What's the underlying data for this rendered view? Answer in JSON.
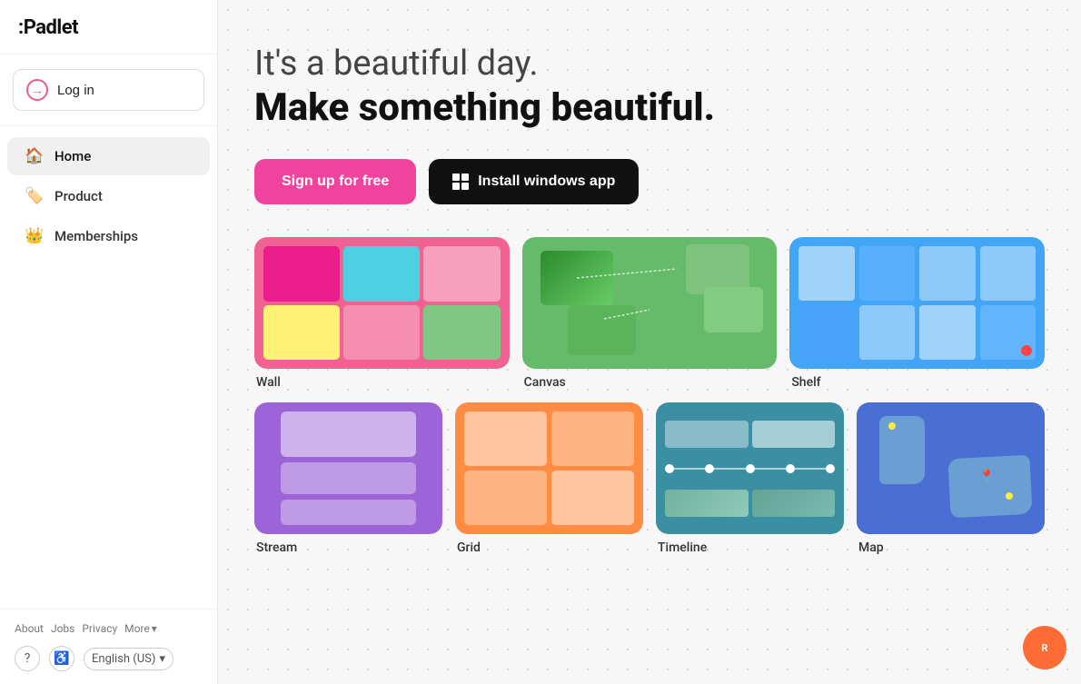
{
  "brand": {
    "logo": ":Padlet"
  },
  "sidebar": {
    "login_label": "Log in",
    "nav_items": [
      {
        "id": "home",
        "label": "Home",
        "icon": "🏠",
        "active": true
      },
      {
        "id": "product",
        "label": "Product",
        "icon": "🏷️",
        "active": false
      },
      {
        "id": "memberships",
        "label": "Memberships",
        "icon": "👑",
        "active": false
      }
    ],
    "footer": {
      "about": "About",
      "jobs": "Jobs",
      "privacy": "Privacy",
      "more": "More",
      "language": "English (US)"
    }
  },
  "hero": {
    "line1": "It's a beautiful day.",
    "line2": "Make something beautiful.",
    "cta_signup": "Sign up for free",
    "cta_install": "Install windows app"
  },
  "cards": {
    "row1": [
      {
        "id": "wall",
        "label": "Wall",
        "color": "#f06292"
      },
      {
        "id": "canvas",
        "label": "Canvas",
        "color": "#66bb6a"
      },
      {
        "id": "shelf",
        "label": "Shelf",
        "color": "#42a5f5"
      }
    ],
    "row2": [
      {
        "id": "stream",
        "label": "Stream",
        "color": "#9c64d6"
      },
      {
        "id": "grid",
        "label": "Grid",
        "color": "#ff8c42"
      },
      {
        "id": "timeline",
        "label": "Timeline",
        "color": "#3a8fa3"
      },
      {
        "id": "map",
        "label": "Map",
        "color": "#3b5fc0"
      }
    ]
  }
}
